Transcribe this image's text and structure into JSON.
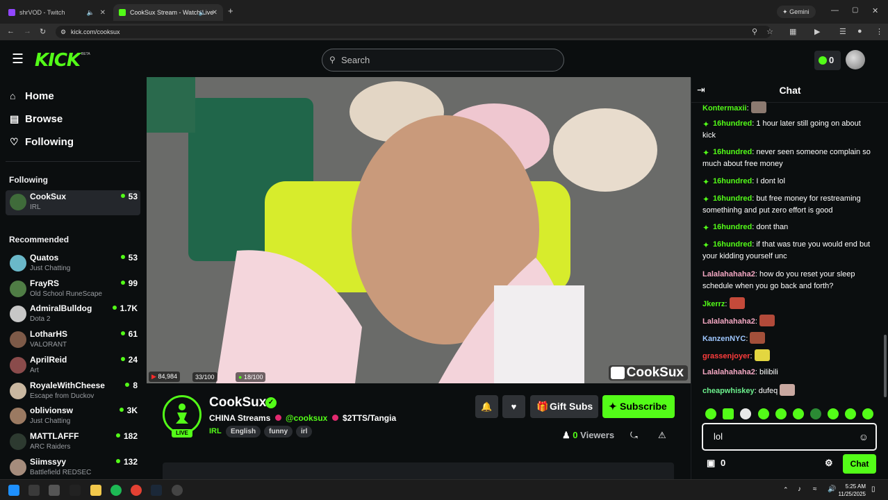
{
  "browser": {
    "tabs": [
      {
        "title": "shrVOD - Twitch",
        "active": false
      },
      {
        "title": "CookSux Stream - Watch Live",
        "active": true
      }
    ],
    "new_tab": "+",
    "gemini_label": "Gemini",
    "url": "kick.com/cooksux"
  },
  "header": {
    "logo": "KICK",
    "logo_beta": "BETA",
    "search_placeholder": "Search",
    "coins": "0"
  },
  "sidebar": {
    "nav": [
      {
        "label": "Home",
        "icon": "home-icon"
      },
      {
        "label": "Browse",
        "icon": "browse-icon"
      },
      {
        "label": "Following",
        "icon": "heart-icon"
      }
    ],
    "following_title": "Following",
    "following": [
      {
        "name": "CookSux",
        "category": "IRL",
        "viewers": "53",
        "color": "#3f6b3a"
      }
    ],
    "recommended_title": "Recommended",
    "recommended": [
      {
        "name": "Quatos",
        "category": "Just Chatting",
        "viewers": "53",
        "color": "#6ab8c9"
      },
      {
        "name": "FrayRS",
        "category": "Old School RuneScape",
        "viewers": "99",
        "color": "#4f7d45"
      },
      {
        "name": "AdmiralBulldog",
        "category": "Dota 2",
        "viewers": "1.7K",
        "color": "#c7c7c7"
      },
      {
        "name": "LotharHS",
        "category": "VALORANT",
        "viewers": "61",
        "color": "#7d5a48"
      },
      {
        "name": "AprilReid",
        "category": "Art",
        "viewers": "24",
        "color": "#8a4b4b"
      },
      {
        "name": "RoyaleWithCheese",
        "category": "Escape from Duckov",
        "viewers": "8",
        "color": "#c9b7a0"
      },
      {
        "name": "oblivionsw",
        "category": "Just Chatting",
        "viewers": "3K",
        "color": "#9b7a62"
      },
      {
        "name": "MATTLAFFF",
        "category": "ARC Raiders",
        "viewers": "182",
        "color": "#2d3a30"
      },
      {
        "name": "Siimssyy",
        "category": "Battlefield REDSEC",
        "viewers": "132",
        "color": "#a58c7c"
      }
    ]
  },
  "video": {
    "yt_count": "84,984",
    "stat2": "33/100",
    "stat3": "18/100",
    "watermark": "CookSux"
  },
  "channel": {
    "name": "CookSux",
    "live": "LIVE",
    "title_parts": [
      "CHINA Streams",
      "@cooksux",
      "$2TTS/Tangia"
    ],
    "category": "IRL",
    "tags": [
      "English",
      "funny",
      "irl"
    ],
    "gift_label": "Gift Subs",
    "subscribe_label": "Subscribe",
    "viewers_count": "0",
    "viewers_label": "Viewers"
  },
  "chat": {
    "title": "Chat",
    "messages": [
      {
        "user": "Kontermaxii",
        "color": "#53fc18",
        "text": "",
        "badge": false,
        "emote": "#8c7a70"
      },
      {
        "user": "16hundred",
        "color": "#53fc18",
        "text": "1 hour later still going on about kick",
        "badge": true
      },
      {
        "user": "16hundred",
        "color": "#53fc18",
        "text": "never seen someone complain so much about free money",
        "badge": true
      },
      {
        "user": "16hundred",
        "color": "#53fc18",
        "text": "I dont lol",
        "badge": true
      },
      {
        "user": "16hundred",
        "color": "#53fc18",
        "text": "but free money for restreaming somethinhg and put zero effort is good",
        "badge": true
      },
      {
        "user": "16hundred",
        "color": "#53fc18",
        "text": "dont than",
        "badge": true
      },
      {
        "user": "16hundred",
        "color": "#53fc18",
        "text": "if that was true you would end but your kidding yourself unc",
        "badge": true
      },
      {
        "user": "Lalalahahaha2",
        "color": "#f4a8c3",
        "text": "how do you reset your sleep schedule when you go back and forth?",
        "badge": false
      },
      {
        "user": "Jkerrz",
        "color": "#53fc18",
        "text": "",
        "badge": false,
        "emote": "#c44a3a"
      },
      {
        "user": "Lalalahahaha2",
        "color": "#f4a8c3",
        "text": "",
        "badge": false,
        "emote": "#b24a3a"
      },
      {
        "user": "KanzenNYC",
        "color": "#9ec7ff",
        "text": "",
        "badge": false,
        "emote": "#a3503a"
      },
      {
        "user": "grassenjoyer",
        "color": "#ff3c3c",
        "text": "",
        "badge": false,
        "emote": "#e3d640"
      },
      {
        "user": "Lalalahahaha2",
        "color": "#f4a8c3",
        "text": "bilibili",
        "badge": false
      },
      {
        "user": "cheapwhiskey",
        "color": "#6cf08d",
        "text": "dufeq",
        "badge": false,
        "emote": "#c9a8a0"
      }
    ],
    "input_value": "lol",
    "coin_count": "0",
    "send_label": "Chat"
  },
  "taskbar": {
    "time": "5:25 AM",
    "date": "11/25/2025"
  }
}
